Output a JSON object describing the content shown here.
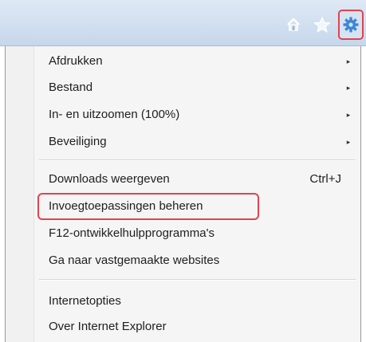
{
  "toolbar": {
    "icons": [
      "home-icon",
      "favorites-star-icon",
      "tools-gear-icon"
    ],
    "accent_highlight": "#e0434e"
  },
  "menu": {
    "group1": [
      {
        "label": "Afdrukken",
        "has_submenu": true
      },
      {
        "label": "Bestand",
        "has_submenu": true
      },
      {
        "label": "In- en uitzoomen (100%)",
        "has_submenu": true
      },
      {
        "label": "Beveiliging",
        "has_submenu": true
      }
    ],
    "group2": [
      {
        "label": "Downloads weergeven",
        "shortcut": "Ctrl+J"
      },
      {
        "label": "Invoegtoepassingen beheren"
      },
      {
        "label": "F12-ontwikkelhulpprogramma's"
      },
      {
        "label": "Ga naar vastgemaakte websites"
      }
    ],
    "group3": [
      {
        "label": "Internetopties"
      },
      {
        "label": "Over Internet Explorer"
      }
    ],
    "submenu_arrow": "▸"
  }
}
